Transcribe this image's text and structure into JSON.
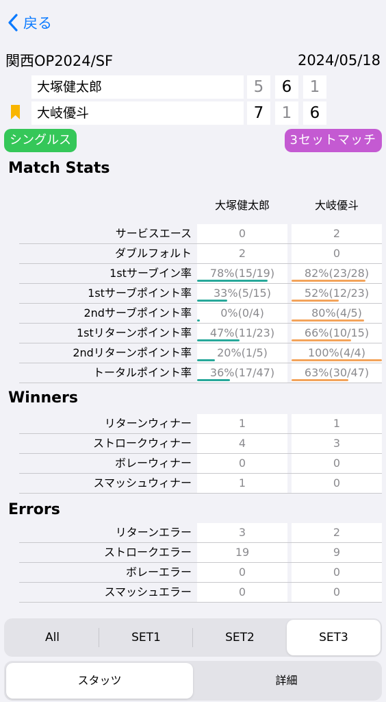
{
  "nav": {
    "back_label": "戻る"
  },
  "match": {
    "title": "関西OP2024/SF",
    "date": "2024/05/18",
    "players": [
      {
        "name": "大塚健太郎",
        "sets": [
          "5",
          "6",
          "1"
        ],
        "bookmarked": false
      },
      {
        "name": "大岐優斗",
        "sets": [
          "7",
          "1",
          "6"
        ],
        "bookmarked": true
      }
    ],
    "type_tag": "シングルス",
    "format_tag": "3セットマッチ"
  },
  "sections": {
    "match_stats": "Match Stats",
    "winners": "Winners",
    "errors": "Errors"
  },
  "columns": {
    "p1": "大塚健太郎",
    "p2": "大岐優斗"
  },
  "match_stats": [
    {
      "label": "サービスエース",
      "p1": "0",
      "p2": "2"
    },
    {
      "label": "ダブルフォルト",
      "p1": "2",
      "p2": "0"
    },
    {
      "label": "1stサーブイン率",
      "p1": "78%(15/19)",
      "p2": "82%(23/28)",
      "p1_pct": 0.78,
      "p2_pct": 0.82
    },
    {
      "label": "1stサーブポイント率",
      "p1": "33%(5/15)",
      "p2": "52%(12/23)",
      "p1_pct": 0.33,
      "p2_pct": 0.52
    },
    {
      "label": "2ndサーブポイント率",
      "p1": "0%(0/4)",
      "p2": "80%(4/5)",
      "p1_pct": 0.0,
      "p2_pct": 0.8
    },
    {
      "label": "1stリターンポイント率",
      "p1": "47%(11/23)",
      "p2": "66%(10/15)",
      "p1_pct": 0.47,
      "p2_pct": 0.66
    },
    {
      "label": "2ndリターンポイント率",
      "p1": "20%(1/5)",
      "p2": "100%(4/4)",
      "p1_pct": 0.2,
      "p2_pct": 1.0
    },
    {
      "label": "トータルポイント率",
      "p1": "36%(17/47)",
      "p2": "63%(30/47)",
      "p1_pct": 0.36,
      "p2_pct": 0.63
    }
  ],
  "winners": [
    {
      "label": "リターンウィナー",
      "p1": "1",
      "p2": "1"
    },
    {
      "label": "ストロークウィナー",
      "p1": "4",
      "p2": "3"
    },
    {
      "label": "ボレーウィナー",
      "p1": "0",
      "p2": "0"
    },
    {
      "label": "スマッシュウィナー",
      "p1": "1",
      "p2": "0"
    }
  ],
  "errors": [
    {
      "label": "リターンエラー",
      "p1": "3",
      "p2": "2"
    },
    {
      "label": "ストロークエラー",
      "p1": "19",
      "p2": "9"
    },
    {
      "label": "ボレーエラー",
      "p1": "0",
      "p2": "0"
    },
    {
      "label": "スマッシュエラー",
      "p1": "0",
      "p2": "0"
    }
  ],
  "set_tabs": {
    "items": [
      "All",
      "SET1",
      "SET2",
      "SET3"
    ],
    "selected": "SET3"
  },
  "view_tabs": {
    "items": [
      "スタッツ",
      "詳細"
    ],
    "selected": "スタッツ"
  },
  "colors": {
    "accent": "#0a7aff",
    "p1_bar": "#27a89a",
    "p2_bar": "#f3a35a",
    "bookmark": "#f9b500"
  }
}
